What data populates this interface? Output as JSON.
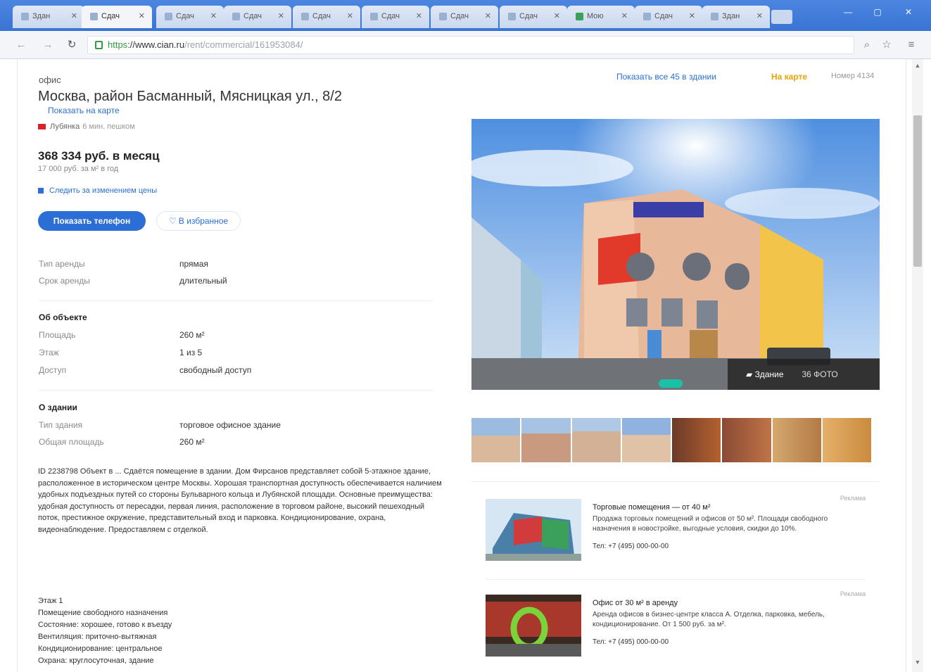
{
  "browser": {
    "tabs": [
      {
        "label": "Здан",
        "active": false
      },
      {
        "label": "Сдач",
        "active": true
      },
      {
        "label": "Сдач",
        "active": false
      },
      {
        "label": "Сдач",
        "active": false
      },
      {
        "label": "Сдач",
        "active": false
      },
      {
        "label": "Сдач",
        "active": false
      },
      {
        "label": "Сдач",
        "active": false
      },
      {
        "label": "Сдач",
        "active": false
      },
      {
        "label": "Мою",
        "active": false
      },
      {
        "label": "Сдач",
        "active": false
      },
      {
        "label": "Здан",
        "active": false
      }
    ],
    "url_scheme": "https",
    "url_host": "://www.cian.ru",
    "url_path": "/rent/commercial/161953084/"
  },
  "listing": {
    "type": "офис",
    "address": "Москва, район Басманный, Мясницкая ул., 8/2",
    "map_link": "Показать на карте",
    "metro": "Лубянка",
    "metro_time": "6 мин. пешком",
    "price": "368 334 руб. в месяц",
    "price_sub": "17 000 руб. за м² в год",
    "price_watch": "Следить за изменением цены",
    "phone_button": "Показать телефон",
    "favorite_button": "В избранное",
    "top_similar": "Показать все 45 в здании",
    "top_map": "На карте",
    "top_views": "Номер 4134",
    "photo_label": "Здание",
    "photo_count": "36 ФОТО",
    "deal": [
      {
        "k": "Тип аренды",
        "v": "прямая"
      },
      {
        "k": "Срок аренды",
        "v": "длительный"
      }
    ],
    "about_title": "Об объекте",
    "about": [
      {
        "k": "Площадь",
        "v": "260 м²"
      },
      {
        "k": "Этаж",
        "v": "1 из 5"
      },
      {
        "k": "Доступ",
        "v": "свободный доступ"
      }
    ],
    "building_title": "О здании",
    "building": [
      {
        "k": "Тип здания",
        "v": "торговое офисное здание"
      },
      {
        "k": "Общая площадь",
        "v": "260 м²"
      }
    ],
    "description": "ID 2238798 Объект в ... Сдаётся помещение в здании. Дом Фирсанов представляет собой 5-этажное здание, расположенное в историческом центре Москвы. Хорошая транспортная доступность обеспечивается наличием удобных подъездных путей со стороны Бульварного кольца и Лубянской площади. Основные преимущества: удобная доступность от пересадки, первая линия, расположение в торговом районе, высокий пешеходный поток, престижное окружение, представительный вход и парковка. Кондиционирование, охрана, видеонаблюдение. Предоставляем с отделкой.",
    "list": [
      "Этаж 1",
      "Помещение свободного назначения",
      "Состояние: хорошее, готово к въезду",
      "Вентиляция: приточно-вытяжная",
      "Кондиционирование: центральное",
      "Охрана: круглосуточная, здание"
    ]
  },
  "ads": [
    {
      "mark": "Реклама",
      "title": "Торговые помещения — от 40 м²",
      "text": "Продажа торговых помещений и офисов от 50 м². Площади свободного назначения в новостройке, выгодные условия, скидки до 10%.",
      "phone": "Тел: +7 (495) 000-00-00"
    },
    {
      "mark": "Реклама",
      "title": "Офис от 30 м² в аренду",
      "text": "Аренда офисов в бизнес-центре класса А. Отделка, парковка, мебель, кондиционирование. От 1 500 руб. за м².",
      "phone": "Тел: +7 (495) 000-00-00"
    }
  ]
}
